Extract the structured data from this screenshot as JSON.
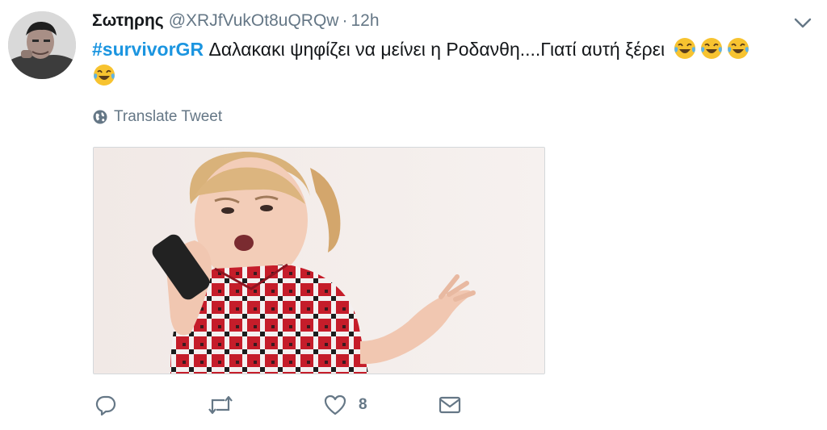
{
  "tweet": {
    "author_name": "Σωτηρης",
    "author_handle": "@XRJfVukOt8uQRQw",
    "separator": "·",
    "timestamp": "12h",
    "hashtag": "#survivorGR",
    "body_text": " Δαλακακι ψηφίζει να μείνει η Ροδανθη....Γιατί αυτή ξέρει",
    "emojis": [
      "face-with-tears-of-joy",
      "face-with-tears-of-joy",
      "face-with-tears-of-joy",
      "face-with-tears-of-joy"
    ],
    "translate_label": "Translate Tweet",
    "media_alt": "little girl shouting at a phone",
    "actions": {
      "reply_icon": "reply-icon",
      "retweet_icon": "retweet-icon",
      "like_icon": "heart-icon",
      "like_count": "8",
      "dm_icon": "envelope-icon"
    }
  },
  "colors": {
    "hashtag": "#1b95e0",
    "secondary_text": "#657786",
    "primary_text": "#14171a"
  }
}
